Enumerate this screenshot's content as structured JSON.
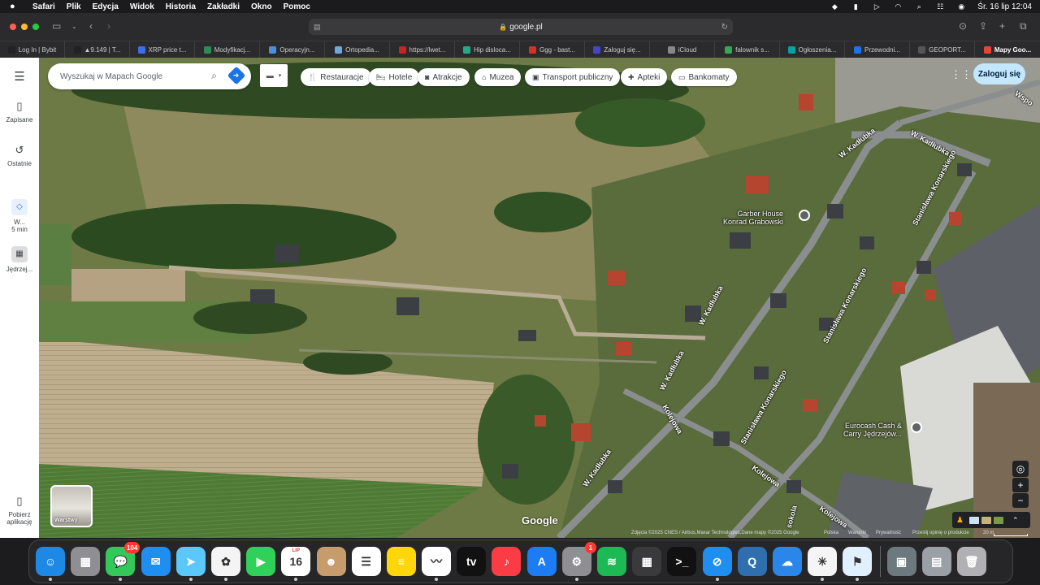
{
  "menubar": {
    "app": "Safari",
    "items": [
      "Plik",
      "Edycja",
      "Widok",
      "Historia",
      "Zakładki",
      "Okno",
      "Pomoc"
    ],
    "clock": "Śr. 16 lip  12:04"
  },
  "toolbar": {
    "url": "google.pl"
  },
  "favorites": [
    {
      "label": "Log In | Bybit",
      "color": "#222"
    },
    {
      "label": "▲9.149 | T...",
      "color": "#222"
    },
    {
      "label": "XRP price t...",
      "color": "#3b6ee8"
    },
    {
      "label": "Modyfikacj...",
      "color": "#2e8b57"
    },
    {
      "label": "Operacyjn...",
      "color": "#4a90d9"
    },
    {
      "label": "Ortopedia...",
      "color": "#6fa8dc"
    },
    {
      "label": "https://lwet...",
      "color": "#cc2222"
    },
    {
      "label": "Hip disloca...",
      "color": "#22aa88"
    },
    {
      "label": "Ggg - bast...",
      "color": "#d93025"
    },
    {
      "label": "Zaloguj się...",
      "color": "#4444cc"
    },
    {
      "label": "iCloud",
      "color": "#888"
    },
    {
      "label": "falownik s...",
      "color": "#34a853"
    },
    {
      "label": "Ogłoszenia...",
      "color": "#00a3a3"
    },
    {
      "label": "Przewodni...",
      "color": "#1a73e8"
    },
    {
      "label": "GEOPORT...",
      "color": "#555"
    },
    {
      "label": "Mapy Goo...",
      "color": "#ea4335"
    }
  ],
  "rail": {
    "saved": "Zapisane",
    "recent": "Ostatnie",
    "recent_trip_a": "W...",
    "recent_trip_b": "5 min",
    "recent_place": "Jędrzej...",
    "get_app_a": "Pobierz",
    "get_app_b": "aplikację"
  },
  "search": {
    "placeholder": "Wyszukaj w Mapach Google"
  },
  "chips": [
    "Restauracje",
    "Hotele",
    "Atrakcje",
    "Muzea",
    "Transport publiczny",
    "Apteki",
    "Bankomaty"
  ],
  "signin": "Zaloguj się",
  "map_labels": {
    "road1": "W. Kadłubka",
    "road2": "W. Kadłubka",
    "road3": "W. Kadłubka",
    "road4": "W. Kadłubka",
    "road5": "W. Kadłubka",
    "road6": "Stanisława Konarskiego",
    "road7": "Stanisława Konarskiego",
    "road8": "Stanisława Konarskiego",
    "road9": "Kolejowa",
    "road10": "Kolejowa",
    "road11": "Kolejowa",
    "road12": "Wspo",
    "road13": "sokola",
    "poi1_a": "Garber House",
    "poi1_b": "Konrad Grabowski",
    "poi2_a": "Eurocash Cash &",
    "poi2_b": "Carry Jędrzejów..."
  },
  "layers_label": "Warstwy",
  "google_logo": "Google",
  "footer": {
    "attribution": "Zdjęcia ©2025 CNES / Airbus,Maxar Technologies,Dane mapy ©2025 Google",
    "country": "Polska",
    "terms": "Warunki",
    "privacy": "Prywatność",
    "feedback": "Prześlij opinię o produkcie",
    "scale": "20 m"
  },
  "dock": [
    {
      "name": "finder",
      "color": "#1e88e5",
      "glyph": "☺"
    },
    {
      "name": "launchpad",
      "color": "#8e8e93",
      "glyph": "▦"
    },
    {
      "name": "messages",
      "color": "#34c759",
      "glyph": "💬",
      "badge": "104"
    },
    {
      "name": "mail",
      "color": "#1f8ef1",
      "glyph": "✉"
    },
    {
      "name": "maps",
      "color": "#5ac8fa",
      "glyph": "➤"
    },
    {
      "name": "photos",
      "color": "#f4f4f4",
      "glyph": "✿"
    },
    {
      "name": "facetime",
      "color": "#30d158",
      "glyph": "▶"
    },
    {
      "name": "calendar",
      "color": "#ffffff",
      "glyph": "16",
      "subtitle": "LIP"
    },
    {
      "name": "contacts",
      "color": "#c69c6d",
      "glyph": "☻"
    },
    {
      "name": "reminders",
      "color": "#ffffff",
      "glyph": "☰"
    },
    {
      "name": "notes",
      "color": "#ffd60a",
      "glyph": "≡"
    },
    {
      "name": "freeform",
      "color": "#ffffff",
      "glyph": "〰"
    },
    {
      "name": "tv",
      "color": "#111111",
      "glyph": "tv"
    },
    {
      "name": "music",
      "color": "#fc3c44",
      "glyph": "♪"
    },
    {
      "name": "app-store",
      "color": "#1c7cf4",
      "glyph": "A"
    },
    {
      "name": "system-settings",
      "color": "#8e8e93",
      "glyph": "⚙",
      "badge": "1"
    },
    {
      "name": "spotify",
      "color": "#1db954",
      "glyph": "≋"
    },
    {
      "name": "calculator",
      "color": "#3a3a3c",
      "glyph": "▦"
    },
    {
      "name": "terminal",
      "color": "#111111",
      "glyph": ">_"
    },
    {
      "name": "safari",
      "color": "#1f8ef1",
      "glyph": "⊘"
    },
    {
      "name": "quicktime",
      "color": "#2f6fb0",
      "glyph": "Q"
    },
    {
      "name": "weather",
      "color": "#2a86e8",
      "glyph": "☁"
    },
    {
      "name": "pinwheel",
      "color": "#f5f5f5",
      "glyph": "✳"
    },
    {
      "name": "vpn",
      "color": "#e0f0ff",
      "glyph": "⚑"
    },
    {
      "name": "sep",
      "color": "",
      "glyph": ""
    },
    {
      "name": "downloads",
      "color": "#6c7a80",
      "glyph": "▣"
    },
    {
      "name": "document",
      "color": "#9aa0a6",
      "glyph": "▤"
    },
    {
      "name": "trash",
      "color": "#b0b0b5",
      "glyph": "🗑"
    }
  ]
}
